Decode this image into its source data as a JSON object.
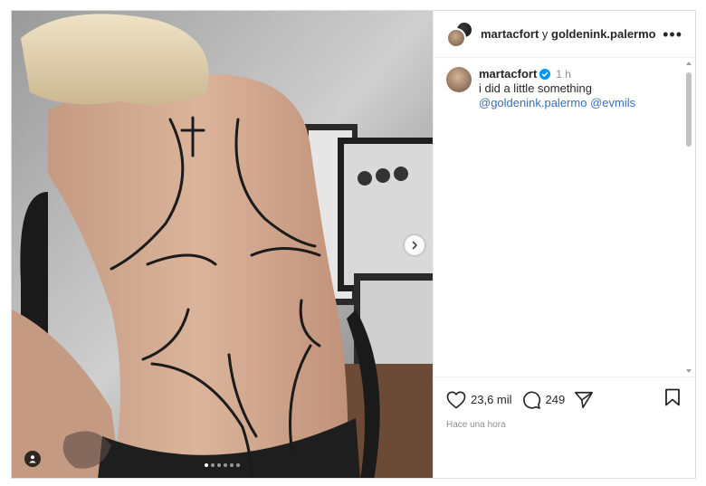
{
  "header": {
    "user1": "martacfort",
    "conjunction": "y",
    "user2": "goldenink.palermo",
    "more_label": "•••"
  },
  "caption": {
    "username": "martacfort",
    "time": "1 h",
    "text": "i did a little something",
    "mention1": "@goldenink.palermo",
    "mention2": "@evmils"
  },
  "actions": {
    "likes": "23,6 mil",
    "comments": "249"
  },
  "timestamp": "Hace una hora",
  "carousel": {
    "count": 6,
    "active": 0
  },
  "colors": {
    "link": "#3b6fb6",
    "verified": "#0095f6",
    "muted": "#8e8e8e"
  }
}
